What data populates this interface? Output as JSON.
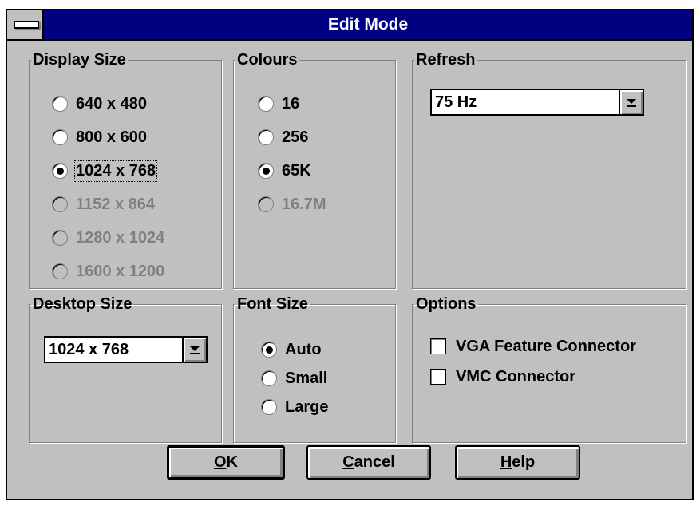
{
  "window": {
    "title": "Edit Mode"
  },
  "display_size": {
    "legend": "Display Size",
    "options": [
      {
        "label": "640 x 480",
        "checked": false,
        "disabled": false
      },
      {
        "label": "800 x 600",
        "checked": false,
        "disabled": false
      },
      {
        "label": "1024 x 768",
        "checked": true,
        "disabled": false
      },
      {
        "label": "1152 x 864",
        "checked": false,
        "disabled": true
      },
      {
        "label": "1280 x 1024",
        "checked": false,
        "disabled": true
      },
      {
        "label": "1600 x 1200",
        "checked": false,
        "disabled": true
      }
    ]
  },
  "colours": {
    "legend": "Colours",
    "options": [
      {
        "label": "16",
        "checked": false,
        "disabled": false
      },
      {
        "label": "256",
        "checked": false,
        "disabled": false
      },
      {
        "label": "65K",
        "checked": true,
        "disabled": false
      },
      {
        "label": "16.7M",
        "checked": false,
        "disabled": true
      }
    ]
  },
  "refresh": {
    "legend": "Refresh",
    "selected": "75 Hz"
  },
  "desktop_size": {
    "legend": "Desktop Size",
    "selected": "1024 x 768"
  },
  "font_size": {
    "legend": "Font Size",
    "options": [
      {
        "label": "Auto",
        "checked": true
      },
      {
        "label": "Small",
        "checked": false
      },
      {
        "label": "Large",
        "checked": false
      }
    ]
  },
  "options": {
    "legend": "Options",
    "items": [
      {
        "label": "VGA Feature Connector",
        "checked": false
      },
      {
        "label": "VMC Connector",
        "checked": false
      }
    ]
  },
  "buttons": {
    "ok": {
      "mnemonic": "O",
      "rest": "K"
    },
    "cancel": {
      "mnemonic": "C",
      "rest": "ancel"
    },
    "help": {
      "mnemonic": "H",
      "rest": "elp"
    }
  }
}
